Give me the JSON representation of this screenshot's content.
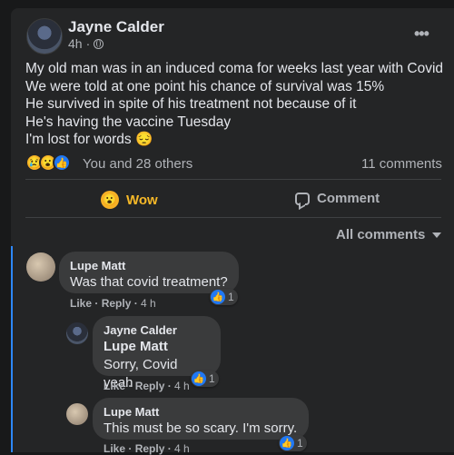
{
  "post": {
    "author": "Jayne Calder",
    "time": "4h",
    "lines": [
      "My old man was in an induced coma for weeks last year with  Covid",
      "We were told at one point his chance of survival was 15%",
      "He survived in spite of his treatment not because of it",
      "He's having the vaccine Tuesday",
      "I'm lost for words 😔"
    ],
    "reactions_text": "You and 28 others",
    "comments_count": "11 comments",
    "reaction_icons": [
      "sad-icon",
      "wow-icon",
      "like-icon"
    ]
  },
  "actions": {
    "wow_label": "Wow",
    "comment_label": "Comment"
  },
  "filter": {
    "label": "All comments"
  },
  "comments": [
    {
      "name": "Lupe Matt",
      "text": "Was that covid treatment?",
      "like": "Like",
      "reply": "Reply",
      "time": "4 h",
      "likes": "1"
    },
    {
      "name": "Jayne Calder",
      "mention": "Lupe Matt",
      "text": "Sorry, Covid yeah",
      "like": "Like",
      "reply": "Reply",
      "time": "4 h",
      "likes": "1"
    },
    {
      "name": "Lupe Matt",
      "text": "This must be so scary. I'm sorry.",
      "like": "Like",
      "reply": "Reply",
      "time": "4 h",
      "likes": "1"
    }
  ],
  "colors": {
    "background": "#18191a",
    "card": "#242526",
    "bubble": "#3a3b3c",
    "accent": "#2d88ff",
    "wow": "#f7b928"
  }
}
